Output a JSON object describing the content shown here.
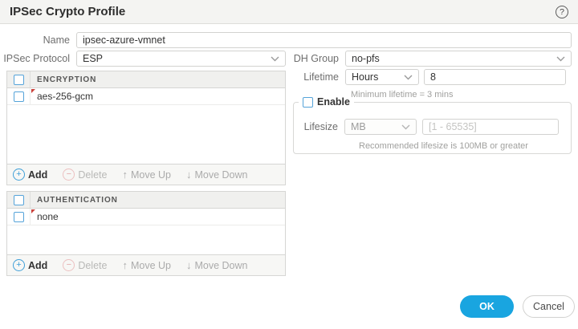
{
  "dialog": {
    "title": "IPSec Crypto Profile"
  },
  "icons": {
    "help": "?",
    "add": "+",
    "delete": "−",
    "move_up": "↑",
    "move_down": "↓"
  },
  "form": {
    "name": {
      "label": "Name",
      "value": "ipsec-azure-vmnet"
    },
    "ipsec_protocol": {
      "label": "IPSec Protocol",
      "value": "ESP"
    },
    "dh_group": {
      "label": "DH Group",
      "value": "no-pfs"
    },
    "lifetime": {
      "label": "Lifetime",
      "unit_value": "Hours",
      "value": "8",
      "note": "Minimum lifetime = 3 mins"
    },
    "lifesize": {
      "enable_label": "Enable",
      "label": "Lifesize",
      "unit_value": "MB",
      "placeholder": "[1 - 65535]",
      "note": "Recommended lifesize is 100MB or greater"
    }
  },
  "encryption_table": {
    "header": "ENCRYPTION",
    "rows": [
      "aes-256-gcm"
    ]
  },
  "authentication_table": {
    "header": "AUTHENTICATION",
    "rows": [
      "none"
    ]
  },
  "toolbar": {
    "add": "Add",
    "delete": "Delete",
    "move_up": "Move Up",
    "move_down": "Move Down"
  },
  "footer": {
    "ok": "OK",
    "cancel": "Cancel"
  },
  "colors": {
    "accent_blue": "#19a5e0",
    "checkbox_border": "#55a3d9",
    "dirty_marker_red": "#c9403a"
  }
}
